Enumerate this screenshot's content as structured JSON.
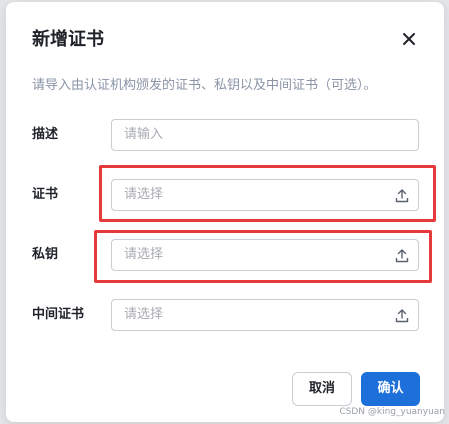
{
  "dialog": {
    "title": "新增证书",
    "close_icon": "close-icon",
    "description": "请导入由认证机构颁发的证书、私钥以及中间证书（可选）。",
    "fields": [
      {
        "label": "描述",
        "placeholder": "请输入",
        "has_upload": false,
        "highlighted": false
      },
      {
        "label": "证书",
        "placeholder": "请选择",
        "has_upload": true,
        "upload_icon": "upload-icon",
        "highlighted": true
      },
      {
        "label": "私钥",
        "placeholder": "请选择",
        "has_upload": true,
        "upload_icon": "upload-icon",
        "highlighted": true
      },
      {
        "label": "中间证书",
        "placeholder": "请选择",
        "has_upload": true,
        "upload_icon": "upload-icon",
        "highlighted": false
      }
    ],
    "buttons": {
      "cancel_label": "取消",
      "ok_label": "确认"
    }
  },
  "colors": {
    "primary": "#1d6fd9",
    "highlight_border": "#e5393b",
    "input_border": "#c9cdd4",
    "placeholder": "#a8abb2",
    "description": "#8a94a6"
  },
  "watermark": "CSDN @king_yuanyuan"
}
